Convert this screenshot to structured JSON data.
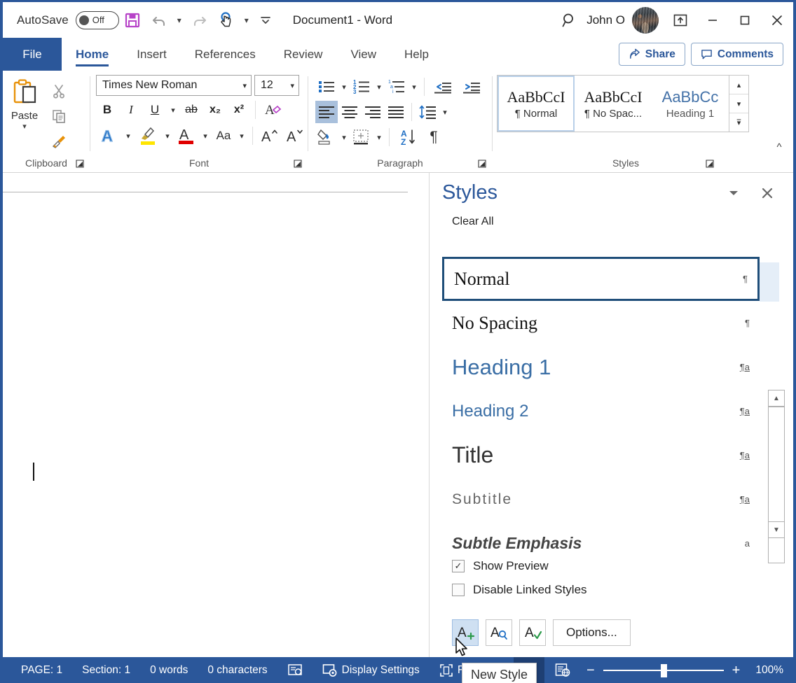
{
  "titlebar": {
    "autosave_label": "AutoSave",
    "autosave_state": "Off",
    "document_title": "Document1  -  Word",
    "user_name": "John O",
    "icons": [
      "save-icon",
      "undo-icon",
      "redo-icon",
      "touch-mouse-mode-icon",
      "customize-qat-icon"
    ],
    "window_controls": [
      "ribbon-display-options",
      "minimize",
      "maximize",
      "close"
    ]
  },
  "tabs": {
    "file": "File",
    "items": [
      {
        "label": "Home",
        "active": true
      },
      {
        "label": "Insert",
        "active": false
      },
      {
        "label": "References",
        "active": false
      },
      {
        "label": "Review",
        "active": false
      },
      {
        "label": "View",
        "active": false
      },
      {
        "label": "Help",
        "active": false
      }
    ],
    "share_label": "Share",
    "comments_label": "Comments"
  },
  "ribbon": {
    "clipboard": {
      "group_label": "Clipboard",
      "paste_label": "Paste",
      "cut_label": "Cut",
      "copy_label": "Copy",
      "format_painter_label": "Format Painter"
    },
    "font": {
      "group_label": "Font",
      "font_name": "Times New Roman",
      "font_size": "12",
      "bold": "B",
      "italic": "I",
      "underline": "U",
      "strikethrough": "ab",
      "subscript": "x₂",
      "superscript": "x²",
      "clear_formatting": "clear-formatting-icon",
      "text_effects": "A",
      "highlight": "highlight-icon",
      "font_color": "A",
      "change_case": "Aa",
      "grow_font": "A",
      "shrink_font": "A"
    },
    "paragraph": {
      "group_label": "Paragraph",
      "bullets": "bullets-icon",
      "numbering": "numbering-icon",
      "multilevel": "multilevel-list-icon",
      "decrease_indent": "decrease-indent-icon",
      "increase_indent": "increase-indent-icon",
      "align_left": "align-left-icon",
      "align_center": "align-center-icon",
      "align_right": "align-right-icon",
      "justify": "justify-icon",
      "line_spacing": "line-spacing-icon",
      "shading": "shading-icon",
      "borders": "borders-icon",
      "sort": "sort-icon",
      "show_marks": "¶"
    },
    "styles": {
      "group_label": "Styles",
      "gallery": [
        {
          "preview": "AaBbCcI",
          "name": "¶ Normal",
          "selected": true,
          "kind": "serif"
        },
        {
          "preview": "AaBbCcI",
          "name": "¶ No Spac...",
          "selected": false,
          "kind": "serif"
        },
        {
          "preview": "AaBbCc",
          "name": "Heading 1",
          "selected": false,
          "kind": "h1"
        }
      ]
    }
  },
  "styles_pane": {
    "title": "Styles",
    "clear_all": "Clear All",
    "items": [
      {
        "name": "Normal",
        "mark": "¶",
        "selected": true,
        "css": "sn-normal"
      },
      {
        "name": "No Spacing",
        "mark": "¶",
        "selected": false,
        "css": "sn-nospace"
      },
      {
        "name": "Heading 1",
        "mark": "¶a",
        "selected": false,
        "css": "sn-h1"
      },
      {
        "name": "Heading 2",
        "mark": "¶a",
        "selected": false,
        "css": "sn-h2"
      },
      {
        "name": "Title",
        "mark": "¶a",
        "selected": false,
        "css": "sn-title"
      },
      {
        "name": "Subtitle",
        "mark": "¶a",
        "selected": false,
        "css": "sn-subtitle"
      },
      {
        "name": "Subtle Emphasis",
        "mark": "a",
        "selected": false,
        "css": "sn-subtle"
      }
    ],
    "show_preview": {
      "label": "Show Preview",
      "checked": true
    },
    "disable_linked": {
      "label": "Disable Linked Styles",
      "checked": false
    },
    "buttons": {
      "new_style": "new-style-icon",
      "style_inspector": "style-inspector-icon",
      "manage_styles": "manage-styles-icon",
      "options": "Options..."
    },
    "tooltip": "New Style"
  },
  "statusbar": {
    "page": "PAGE: 1",
    "section": "Section: 1",
    "words": "0 words",
    "characters": "0 characters",
    "proofing": "proofing-icon",
    "display_settings": "Display Settings",
    "focus": "Focus",
    "view_read": "read-mode-icon",
    "view_print": "print-layout-icon",
    "view_web": "web-layout-icon",
    "zoom_out": "−",
    "zoom_in": "+",
    "zoom_level": "100%"
  },
  "colors": {
    "word_blue": "#2b579a",
    "accent_light": "#cfe0f2",
    "heading_blue": "#3a6ea5"
  }
}
